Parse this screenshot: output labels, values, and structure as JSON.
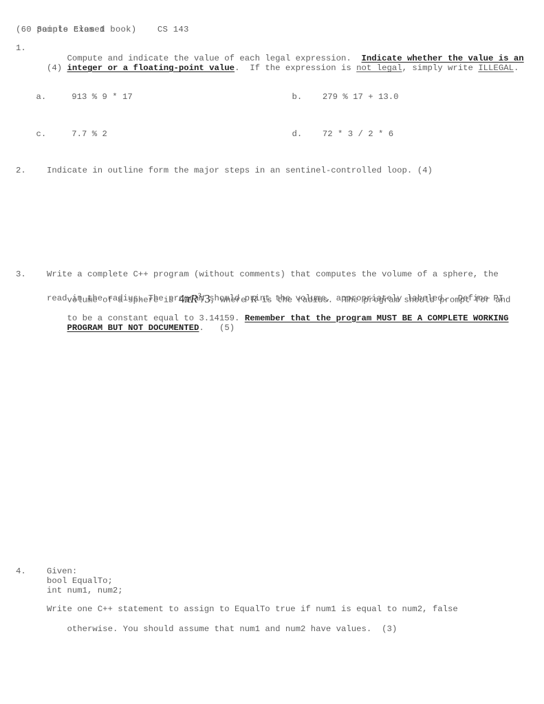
{
  "document": {
    "header": {
      "title": "Sample Exam 1",
      "course": "CS 143",
      "subtitle": "(60 points closed book)"
    },
    "questions": [
      {
        "number": "1.",
        "prompt_part1": "Compute and indicate the value of each legal expression.  ",
        "prompt_emph1": "Indicate whether the value is an",
        "prompt_emph2": "integer or a floating-point value",
        "prompt_part2": ".  If the expression is ",
        "prompt_ul1": "not legal",
        "prompt_part3": ", simply write ",
        "prompt_ul2": "ILLEGAL",
        "prompt_part4": ".",
        "points": "(4)",
        "expressions": [
          {
            "label": "a.",
            "text": "913 % 9 * 17"
          },
          {
            "label": "b.",
            "text": "279 % 17 + 13.0"
          },
          {
            "label": "c.",
            "text": "7.7 % 2"
          },
          {
            "label": "d.",
            "text": "72 * 3 / 2 * 6"
          }
        ]
      },
      {
        "number": "2.",
        "text": "Indicate in outline form the major steps in an sentinel-controlled loop. (4)"
      },
      {
        "number": "3.",
        "line1": "Write a complete C++ program (without comments) that computes the volume of a sphere, the",
        "line2_pre": "volume of a sphere is ",
        "formula": "4πR³/3",
        "formula_coefficient": "4",
        "formula_pi": "π",
        "formula_radius": "R",
        "formula_exponent": "3",
        "formula_divisor": "/3",
        "line2_post": ", where ",
        "line2_var": "R",
        "line2_tail": " is the radius.  The program should prompt for and",
        "line3": "read in the radius. The program should print the volume, appropriately labeled.  Define PI",
        "line4_pre": "to be a constant equal to 3.14159. ",
        "line4_emph": "Remember that the program MUST BE A COMPLETE WORKING",
        "line5_emph": "PROGRAM BUT NOT DOCUMENTED",
        "line5_post": ".",
        "points": "(5)"
      },
      {
        "number": "4.",
        "given_label": "Given:",
        "code_line1": "bool EqualTo;",
        "code_line2": "int num1, num2;",
        "task_line1": "Write one C++ statement to assign to EqualTo true if num1 is equal to num2, false",
        "task_line2": "otherwise. You should assume that num1 and num2 have values.  ",
        "points": "(3)"
      }
    ]
  },
  "style": {
    "body_text_color": "#5d5d5d",
    "emphasis_color": "#1f1f1f",
    "background_color": "#ffffff"
  }
}
